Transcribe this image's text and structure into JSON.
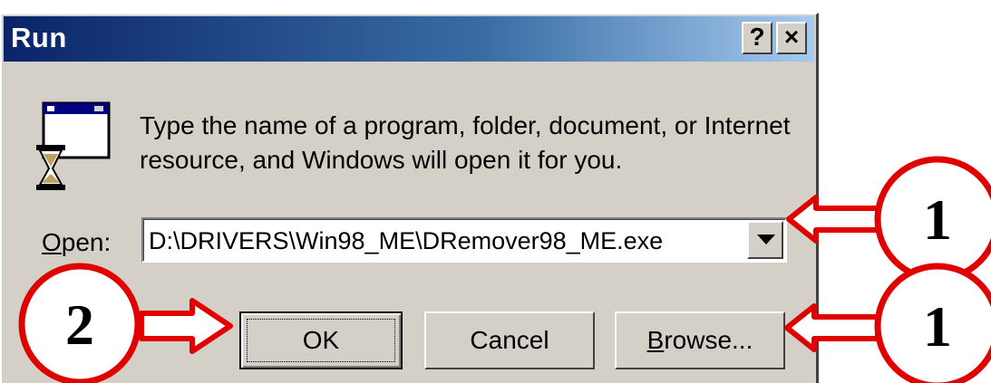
{
  "window": {
    "title": "Run",
    "help_button": "?",
    "close_button": "×"
  },
  "message": "Type the name of a program, folder, document, or Internet resource, and Windows will open it for you.",
  "open_field": {
    "label_mnemonic": "O",
    "label_rest": "pen:",
    "value": "D:\\DRIVERS\\Win98_ME\\DRemover98_ME.exe"
  },
  "buttons": {
    "ok": "OK",
    "cancel": "Cancel",
    "browse_mnemonic": "B",
    "browse_rest": "rowse..."
  },
  "callouts": {
    "top_right": "1",
    "bottom_right": "1",
    "bottom_left": "2",
    "color": "#e00000"
  },
  "icons": {
    "program": "run-program-icon",
    "dropdown": "chevron-down-icon"
  }
}
